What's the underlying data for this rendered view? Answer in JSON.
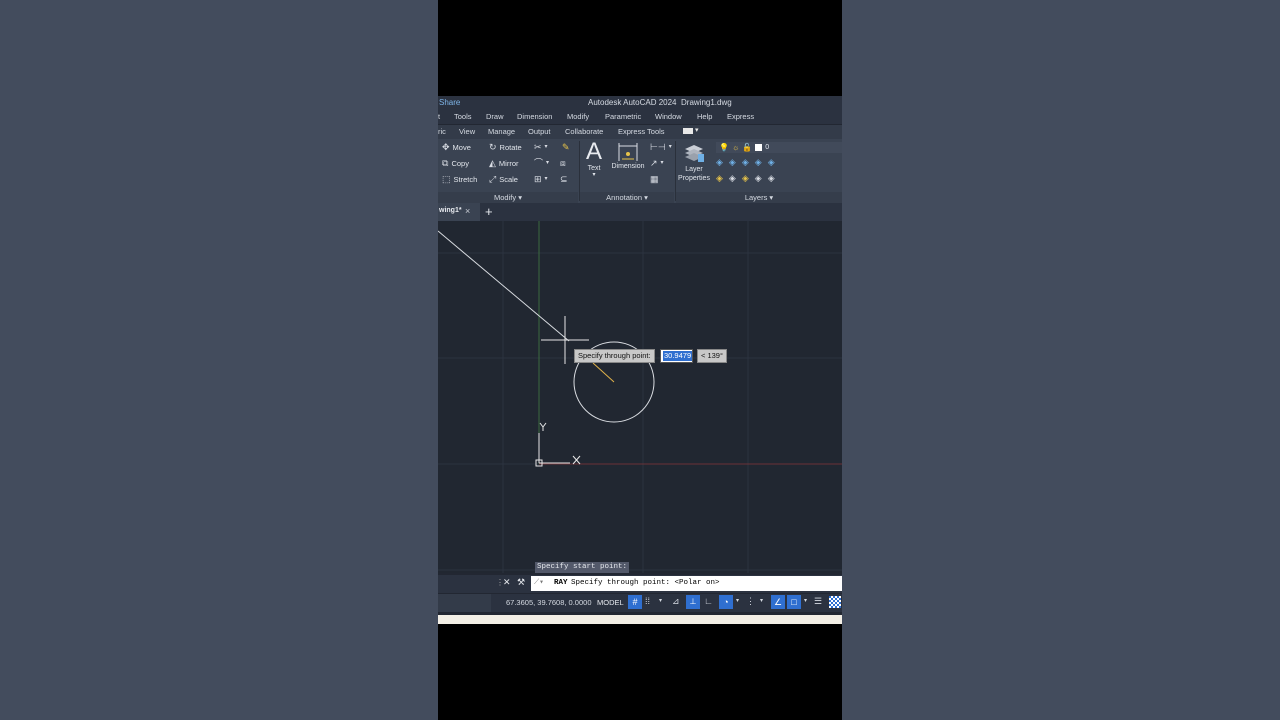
{
  "app": {
    "share_label": "Share",
    "title": "Autodesk AutoCAD 2024",
    "document": "Drawing1.dwg"
  },
  "menu": [
    "t",
    "Tools",
    "Draw",
    "Dimension",
    "Modify",
    "Parametric",
    "Window",
    "Help",
    "Express"
  ],
  "ribbon_tabs": [
    "ric",
    "View",
    "Manage",
    "Output",
    "Collaborate",
    "Express Tools"
  ],
  "ribbon": {
    "modify": {
      "move": "Move",
      "rotate": "Rotate",
      "copy": "Copy",
      "mirror": "Mirror",
      "stretch": "Stretch",
      "scale": "Scale",
      "panel_label": "Modify ▾"
    },
    "annotation": {
      "text": "Text",
      "dimension": "Dimension",
      "panel_label": "Annotation ▾"
    },
    "layers": {
      "layer_properties_1": "Layer",
      "layer_properties_2": "Properties",
      "current_layer": "0",
      "panel_label": "Layers ▾"
    }
  },
  "doc_tab": {
    "label": "wing1*",
    "close": "×",
    "new": "+"
  },
  "canvas": {
    "tooltip_prompt": "Specify through point:",
    "distance_value": "30.9479",
    "angle_value": "< 139°",
    "ucs_y": "Y",
    "ucs_x": "X",
    "history_text": "Specify start point:"
  },
  "command": {
    "name": "RAY",
    "prompt": "Specify through point:  <Polar on>"
  },
  "status": {
    "coordinates": "67.3605, 39.7608, 0.0000",
    "model": "MODEL"
  },
  "colors": {
    "canvas_bg": "#212731",
    "ribbon_bg": "#3a4352",
    "highlight_blue": "#2f6fd0",
    "x_axis": "#8a3a3a",
    "y_axis": "#3a7a3a"
  }
}
